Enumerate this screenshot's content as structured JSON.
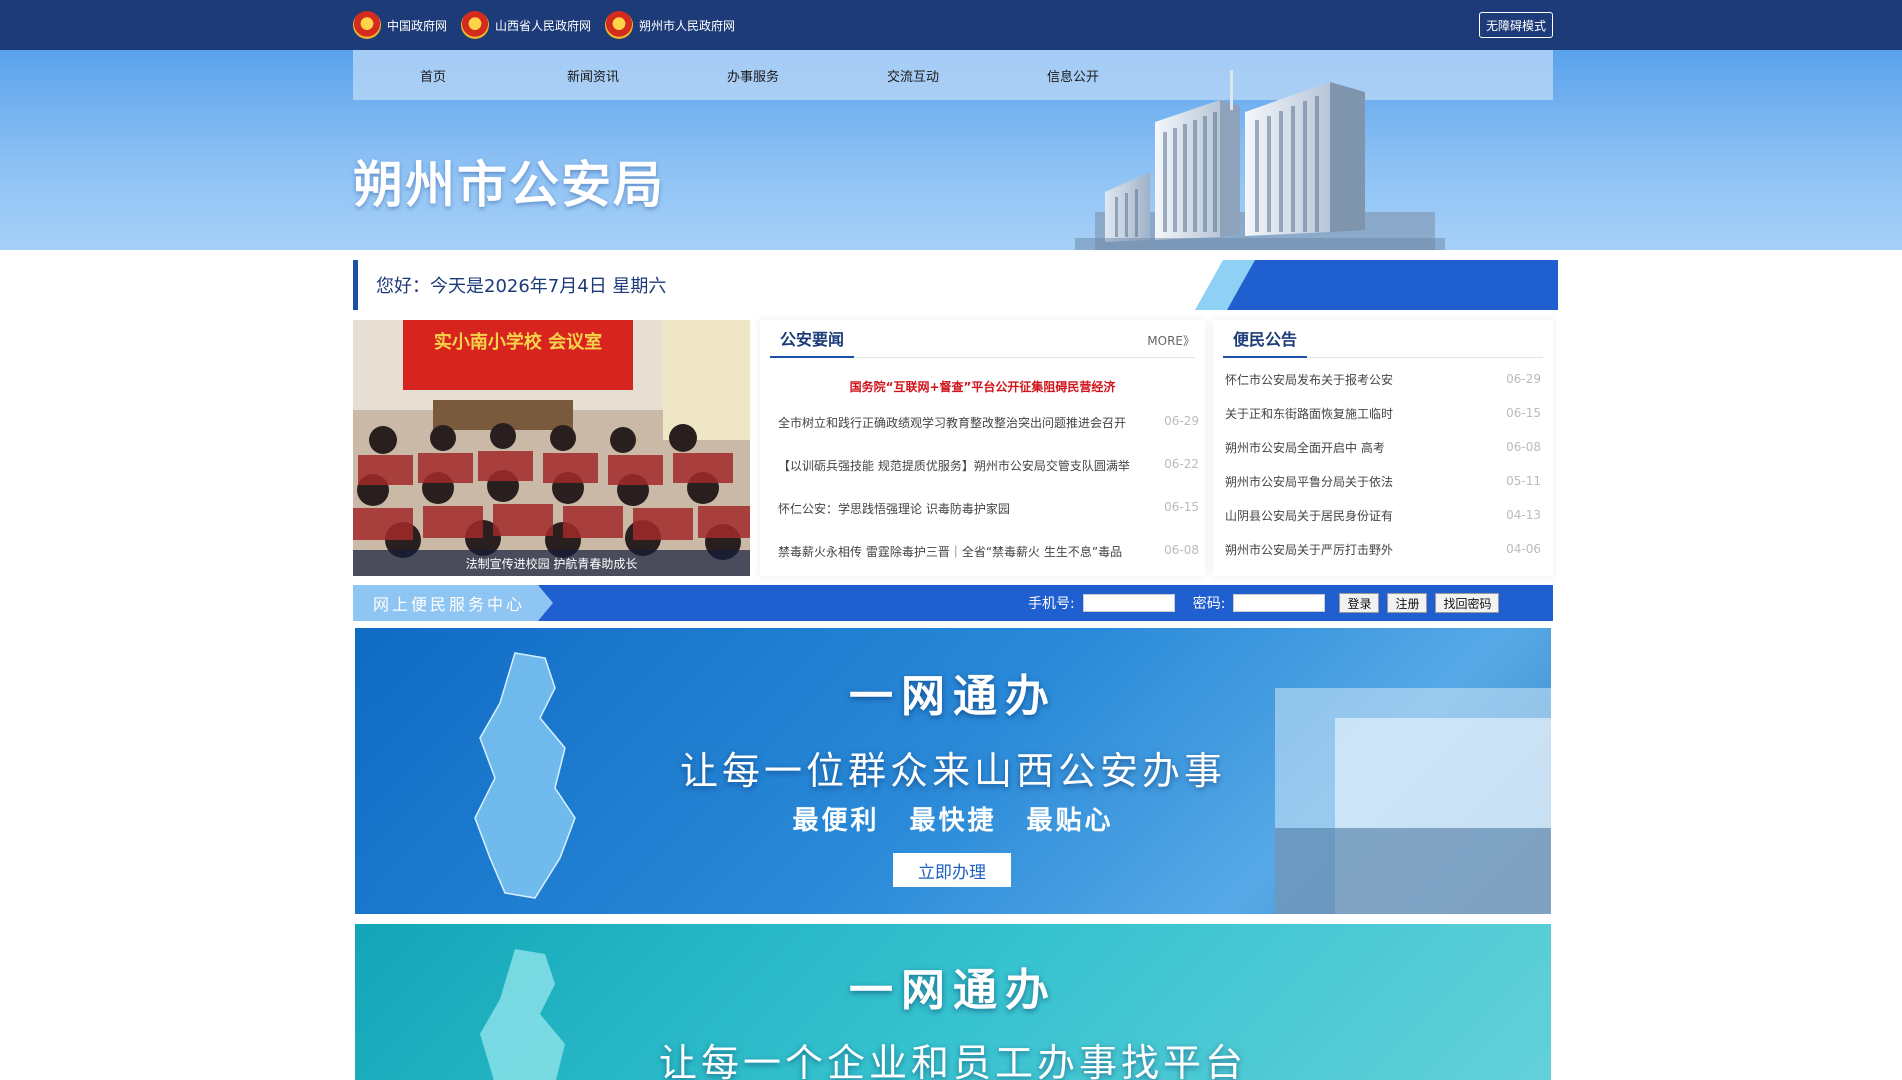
{
  "toplinks": [
    {
      "label": "中国政府网"
    },
    {
      "label": "山西省人民政府网"
    },
    {
      "label": "朔州市人民政府网"
    }
  ],
  "accessibility_label": "无障碍模式",
  "nav": [
    "首页",
    "新闻资讯",
    "办事服务",
    "交流互动",
    "信息公开"
  ],
  "site_title": "朔州市公安局",
  "greeting": "您好：今天是2026年7月4日 星期六",
  "photo": {
    "sign_text": "实小南小学校 会议室",
    "caption": "法制宣传进校园 护航青春助成长"
  },
  "news": {
    "title": "公安要闻",
    "more": "MORE》",
    "headline": "国务院“互联网+督查”平台公开征集阻碍民营经济",
    "items": [
      {
        "title": "全市树立和践行正确政绩观学习教育整改整治突出问题推进会召开",
        "date": "06-29"
      },
      {
        "title": "【以训砺兵强技能 规范提质优服务】朔州市公安局交管支队圆满举",
        "date": "06-22"
      },
      {
        "title": "怀仁公安：学思践悟强理论 识毒防毒护家园",
        "date": "06-15"
      },
      {
        "title": "禁毒薪火永相传 雷霆除毒护三晋｜全省“禁毒薪火 生生不息”毒品",
        "date": "06-08"
      }
    ]
  },
  "notice": {
    "title": "便民公告",
    "items": [
      {
        "title": "怀仁市公安局发布关于报考公安",
        "date": "06-29"
      },
      {
        "title": "关于正和东街路面恢复施工临时",
        "date": "06-15"
      },
      {
        "title": "朔州市公安局全面开启中 高考",
        "date": "06-08"
      },
      {
        "title": "朔州市公安局平鲁分局关于依法",
        "date": "05-11"
      },
      {
        "title": "山阴县公安局关于居民身份证有",
        "date": "04-13"
      },
      {
        "title": "朔州市公安局关于严厉打击野外",
        "date": "04-06"
      }
    ]
  },
  "service": {
    "label": "网上便民服务中心",
    "phone_label": "手机号:",
    "phone_value": "",
    "password_label": "密码:",
    "password_value": "",
    "login": "登录",
    "register": "注册",
    "recover": "找回密码"
  },
  "promo1": {
    "title": "一网通办",
    "subtitle": "让每一位群众来山西公安办事",
    "tags": "最便利 最快捷 最贴心",
    "button": "立即办理"
  },
  "promo2": {
    "title": "一网通办",
    "subtitle": "让每一个企业和员工办事找平台"
  },
  "colors": {
    "topbar": "#1d3b78",
    "accent": "#1d4fa6",
    "headline_red": "#d0141b",
    "service_bar": "#1f5fcf"
  }
}
